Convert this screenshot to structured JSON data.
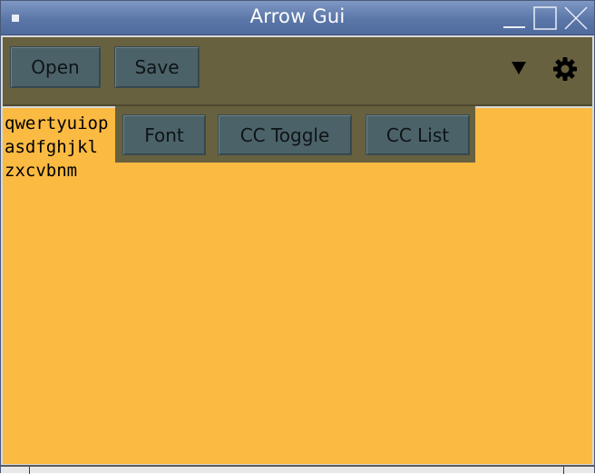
{
  "window": {
    "title": "Arrow Gui"
  },
  "titlebar": {
    "icons": [
      "window-menu-icon",
      "minimize-icon",
      "maximize-icon",
      "close-icon"
    ]
  },
  "toolbar": {
    "open_label": "Open",
    "save_label": "Save",
    "icons": [
      "dropdown-arrow-icon",
      "gear-icon"
    ]
  },
  "popup_menu": {
    "items": [
      {
        "label": "Font"
      },
      {
        "label": "CC Toggle"
      },
      {
        "label": "CC List"
      }
    ]
  },
  "editor": {
    "lines": [
      "qwertyuiop",
      "asdfghjkl",
      "zxcvbnm"
    ]
  },
  "colors": {
    "titlebar": "#5b76a8",
    "toolbar_bg": "#67613f",
    "button_bg": "#4c6269",
    "editor_bg": "#fbba42"
  }
}
